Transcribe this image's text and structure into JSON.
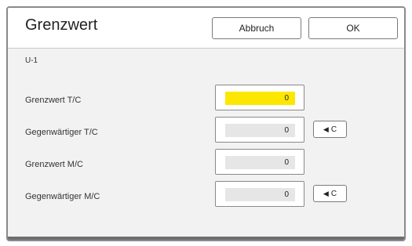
{
  "dialog": {
    "title": "Grenzwert",
    "cancel_label": "Abbruch",
    "ok_label": "OK",
    "subtitle": "U-1"
  },
  "rows": [
    {
      "label": "Grenzwert T/C",
      "value": "0",
      "active": true,
      "has_clear": false
    },
    {
      "label": "Gegenwärtiger T/C",
      "value": "0",
      "active": false,
      "has_clear": true
    },
    {
      "label": "Grenzwert M/C",
      "value": "0",
      "active": false,
      "has_clear": false
    },
    {
      "label": "Gegenwärtiger M/C",
      "value": "0",
      "active": false,
      "has_clear": true
    }
  ],
  "clear_button": {
    "arrow": "◀",
    "label": "C",
    "icon": "left-triangle-icon"
  },
  "colors": {
    "active_field": "#fde700",
    "inactive_field": "#e6e6e6",
    "panel_background": "#f2f2f2",
    "border": "#8a8a8a"
  }
}
